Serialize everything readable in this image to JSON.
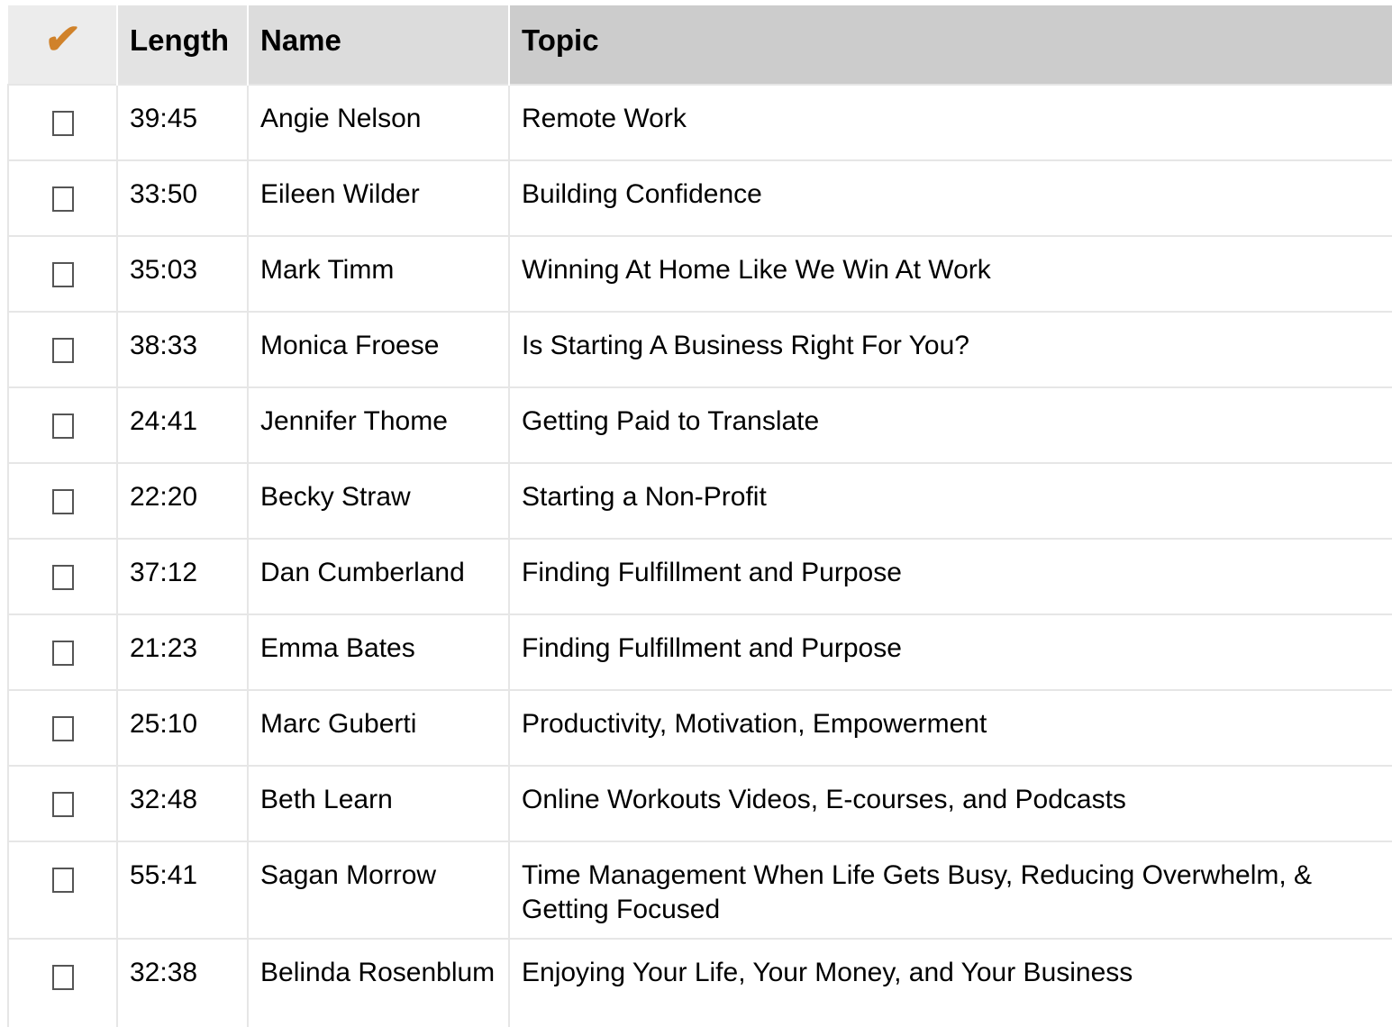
{
  "header": {
    "check_symbol": "✔",
    "length": "Length",
    "name": "Name",
    "topic": "Topic"
  },
  "colors": {
    "check_accent": "#d0822a"
  },
  "rows": [
    {
      "length": "39:45",
      "name": "Angie Nelson",
      "topic": "Remote Work",
      "checked": false
    },
    {
      "length": "33:50",
      "name": "Eileen Wilder",
      "topic": "Building Confidence",
      "checked": false
    },
    {
      "length": "35:03",
      "name": "Mark Timm",
      "topic": "Winning At Home Like We Win At Work",
      "checked": false
    },
    {
      "length": "38:33",
      "name": "Monica Froese",
      "topic": "Is Starting A Business Right For You?",
      "checked": false
    },
    {
      "length": "24:41",
      "name": "Jennifer Thome",
      "topic": "Getting Paid to Translate",
      "checked": false
    },
    {
      "length": "22:20",
      "name": "Becky Straw",
      "topic": "Starting a Non-Profit",
      "checked": false
    },
    {
      "length": "37:12",
      "name": "Dan Cumberland",
      "topic": "Finding Fulfillment and Purpose",
      "checked": false
    },
    {
      "length": "21:23",
      "name": "Emma Bates",
      "topic": "Finding Fulfillment and Purpose",
      "checked": false
    },
    {
      "length": "25:10",
      "name": "Marc Guberti",
      "topic": "Productivity, Motivation, Empowerment",
      "checked": false
    },
    {
      "length": "32:48",
      "name": "Beth Learn",
      "topic": "Online Workouts Videos, E-courses, and Podcasts",
      "checked": false
    },
    {
      "length": "55:41",
      "name": "Sagan Morrow",
      "topic": "Time Management When Life Gets Busy, Reducing Overwhelm, & Getting Focused",
      "checked": false
    },
    {
      "length": "32:38",
      "name": "Belinda Rosenblum",
      "topic": "Enjoying Your Life, Your Money, and Your Business",
      "checked": false
    }
  ]
}
